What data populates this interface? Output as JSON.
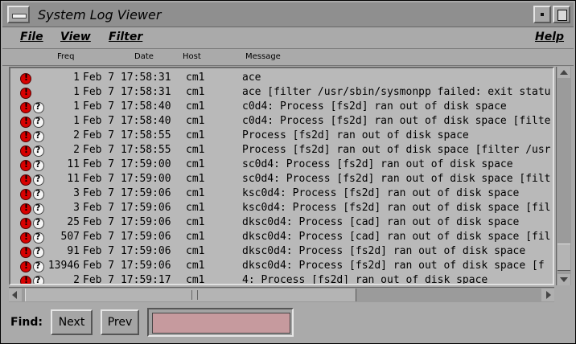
{
  "window": {
    "title": "System Log Viewer"
  },
  "menu": {
    "file": "File",
    "view": "View",
    "filter": "Filter",
    "help": "Help"
  },
  "columns": {
    "freq": "Freq",
    "date": "Date",
    "host": "Host",
    "message": "Message"
  },
  "rows": [
    {
      "q": false,
      "freq": "1",
      "date": "Feb  7 17:58:31",
      "host": "cm1",
      "message": "ace"
    },
    {
      "q": false,
      "freq": "1",
      "date": "Feb  7 17:58:31",
      "host": "cm1",
      "message": "ace [filter /usr/sbin/sysmonpp failed: exit statu"
    },
    {
      "q": true,
      "freq": "1",
      "date": "Feb  7 17:58:40",
      "host": "cm1",
      "message": "c0d4: Process [fs2d] ran out of disk space"
    },
    {
      "q": true,
      "freq": "1",
      "date": "Feb  7 17:58:40",
      "host": "cm1",
      "message": "c0d4: Process [fs2d] ran out of disk space [filte"
    },
    {
      "q": true,
      "freq": "2",
      "date": "Feb  7 17:58:55",
      "host": "cm1",
      "message": "Process [fs2d] ran out of disk space"
    },
    {
      "q": true,
      "freq": "2",
      "date": "Feb  7 17:58:55",
      "host": "cm1",
      "message": "Process [fs2d] ran out of disk space [filter /usr"
    },
    {
      "q": true,
      "freq": "11",
      "date": "Feb  7 17:59:00",
      "host": "cm1",
      "message": "sc0d4: Process [fs2d] ran out of disk space"
    },
    {
      "q": true,
      "freq": "11",
      "date": "Feb  7 17:59:00",
      "host": "cm1",
      "message": "sc0d4: Process [fs2d] ran out of disk space [filt"
    },
    {
      "q": true,
      "freq": "3",
      "date": "Feb  7 17:59:06",
      "host": "cm1",
      "message": "ksc0d4: Process [fs2d] ran out of disk space"
    },
    {
      "q": true,
      "freq": "3",
      "date": "Feb  7 17:59:06",
      "host": "cm1",
      "message": "ksc0d4: Process [fs2d] ran out of disk space [fil"
    },
    {
      "q": true,
      "freq": "25",
      "date": "Feb  7 17:59:06",
      "host": "cm1",
      "message": "dksc0d4: Process [cad] ran out of disk space"
    },
    {
      "q": true,
      "freq": "507",
      "date": "Feb  7 17:59:06",
      "host": "cm1",
      "message": "dksc0d4: Process [cad] ran out of disk space [fil"
    },
    {
      "q": true,
      "freq": "91",
      "date": "Feb  7 17:59:06",
      "host": "cm1",
      "message": "dksc0d4: Process [fs2d] ran out of disk space"
    },
    {
      "q": true,
      "freq": "13946",
      "date": "Feb  7 17:59:06",
      "host": "cm1",
      "message": "dksc0d4: Process [fs2d] ran out of disk space [f"
    },
    {
      "q": true,
      "freq": "2",
      "date": "Feb  7 17:59:17",
      "host": "cm1",
      "message": "4: Process [fs2d] ran out of disk space"
    }
  ],
  "find": {
    "label": "Find:",
    "next": "Next",
    "prev": "Prev",
    "value": ""
  }
}
